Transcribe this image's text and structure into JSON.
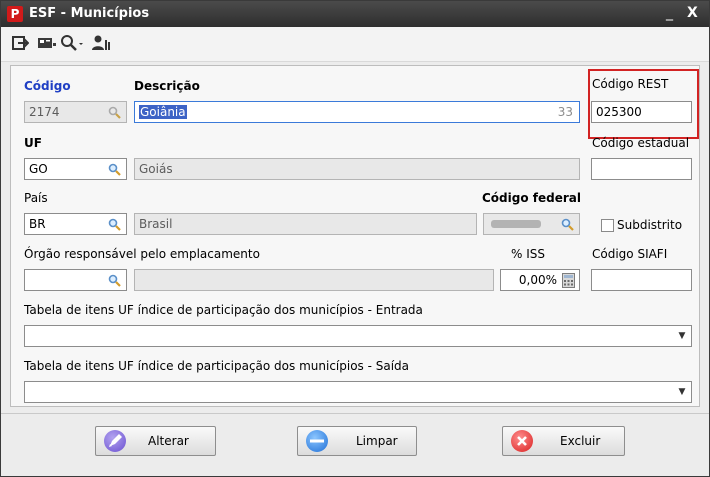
{
  "window": {
    "title": "ESF - Municípios",
    "logo_letter": "P",
    "minimize_label": "_",
    "close_label": "X"
  },
  "form": {
    "codigo": {
      "label": "Código",
      "value": "2174"
    },
    "descricao": {
      "label": "Descrição",
      "value": "Goiânia",
      "counter": "33"
    },
    "codigo_rest": {
      "label": "Código REST",
      "value": "025300"
    },
    "uf": {
      "label": "UF",
      "code": "GO",
      "name": "Goiás"
    },
    "codigo_estadual": {
      "label": "Código estadual",
      "value": ""
    },
    "pais": {
      "label": "País",
      "code": "BR",
      "name": "Brasil"
    },
    "codigo_federal": {
      "label": "Código federal"
    },
    "subdistrito": {
      "label": "Subdistrito"
    },
    "orgao": {
      "label": "Órgão responsável pelo emplacamento",
      "code": "",
      "name": ""
    },
    "iss": {
      "label": "% ISS",
      "value": "0,00%"
    },
    "siafi": {
      "label": "Código SIAFI",
      "value": ""
    },
    "tabela_entrada": {
      "label": "Tabela de itens UF índice de participação dos municípios - Entrada",
      "value": ""
    },
    "tabela_saida": {
      "label": "Tabela de itens UF índice de participação dos municípios - Saída",
      "value": ""
    }
  },
  "buttons": {
    "alterar": "Alterar",
    "limpar": "Limpar",
    "excluir": "Excluir"
  },
  "colors": {
    "title_bar": "#2e2e2e",
    "highlight_border": "#d22323",
    "label_blue": "#1f3fc4",
    "selection": "#3d63c6"
  }
}
